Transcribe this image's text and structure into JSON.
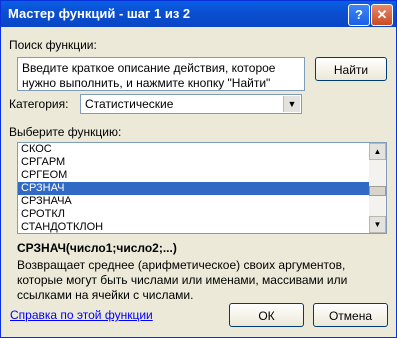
{
  "window": {
    "title": "Мастер функций - шаг 1 из 2",
    "help_glyph": "?",
    "close_glyph": "✕"
  },
  "search": {
    "label": "Поиск функции:",
    "placeholder_text": "Введите краткое описание действия, которое нужно выполнить, и нажмите кнопку \"Найти\"",
    "find_button": "Найти"
  },
  "category": {
    "label": "Категория:",
    "selected": "Статистические"
  },
  "functions": {
    "label": "Выберите функцию:",
    "items": [
      "СКОС",
      "СРГАРМ",
      "СРГЕОМ",
      "СРЗНАЧ",
      "СРЗНАЧА",
      "СРОТКЛ",
      "СТАНДОТКЛОН"
    ],
    "selected_index": 3
  },
  "details": {
    "signature": "СРЗНАЧ(число1;число2;...)",
    "description": "Возвращает среднее (арифметическое) своих аргументов, которые могут быть числами или именами, массивами или ссылками на ячейки с числами."
  },
  "footer": {
    "help_link": "Справка по этой функции",
    "ok_button": "ОК",
    "cancel_button": "Отмена"
  }
}
